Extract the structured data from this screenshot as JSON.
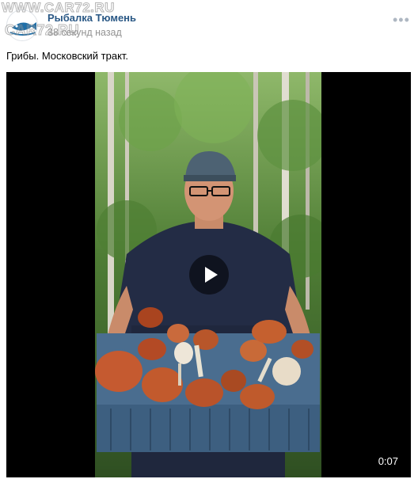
{
  "watermark": {
    "top": "WWW.CAR72.RU",
    "bottom": "CAR72.RU"
  },
  "post": {
    "author": "Рыбалка Тюмень",
    "time": "38 секунд назад",
    "text": "Грибы. Московский тракт.",
    "more_icon": "•••"
  },
  "video": {
    "duration": "0:07"
  },
  "colors": {
    "link": "#2a5885",
    "muted": "#939393",
    "video_bg": "#000000"
  }
}
